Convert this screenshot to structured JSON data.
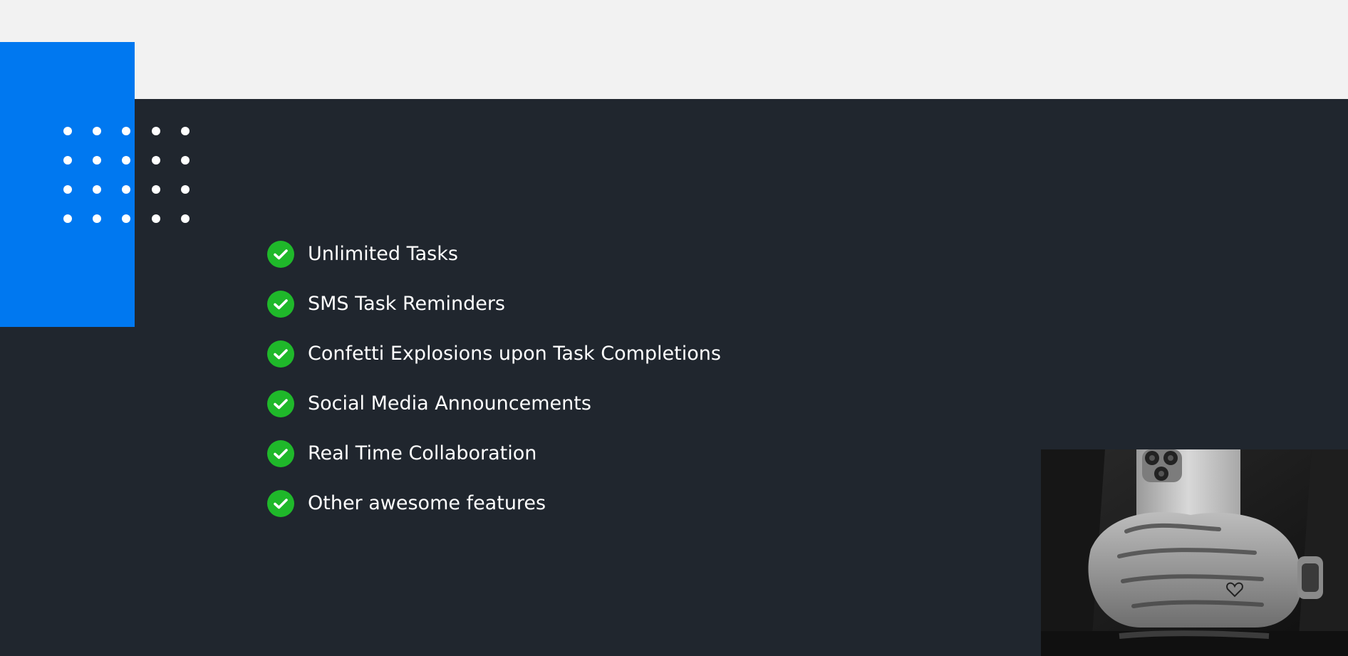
{
  "features": {
    "items": [
      {
        "label": "Unlimited Tasks"
      },
      {
        "label": "SMS Task Reminders"
      },
      {
        "label": "Confetti Explosions upon Task Completions"
      },
      {
        "label": "Social Media Announcements"
      },
      {
        "label": "Real Time Collaboration"
      },
      {
        "label": "Other awesome features"
      }
    ],
    "icon": "check-circle-icon"
  },
  "colors": {
    "page_background": "#f2f2f2",
    "section_background": "#20262e",
    "accent_blue": "#0078f0",
    "check_green": "#1fb82a",
    "text": "#ffffff"
  },
  "decoration": {
    "dot_grid": {
      "rows": 4,
      "cols": 5
    }
  },
  "photo": {
    "subject": "hands-holding-phone-photo"
  }
}
